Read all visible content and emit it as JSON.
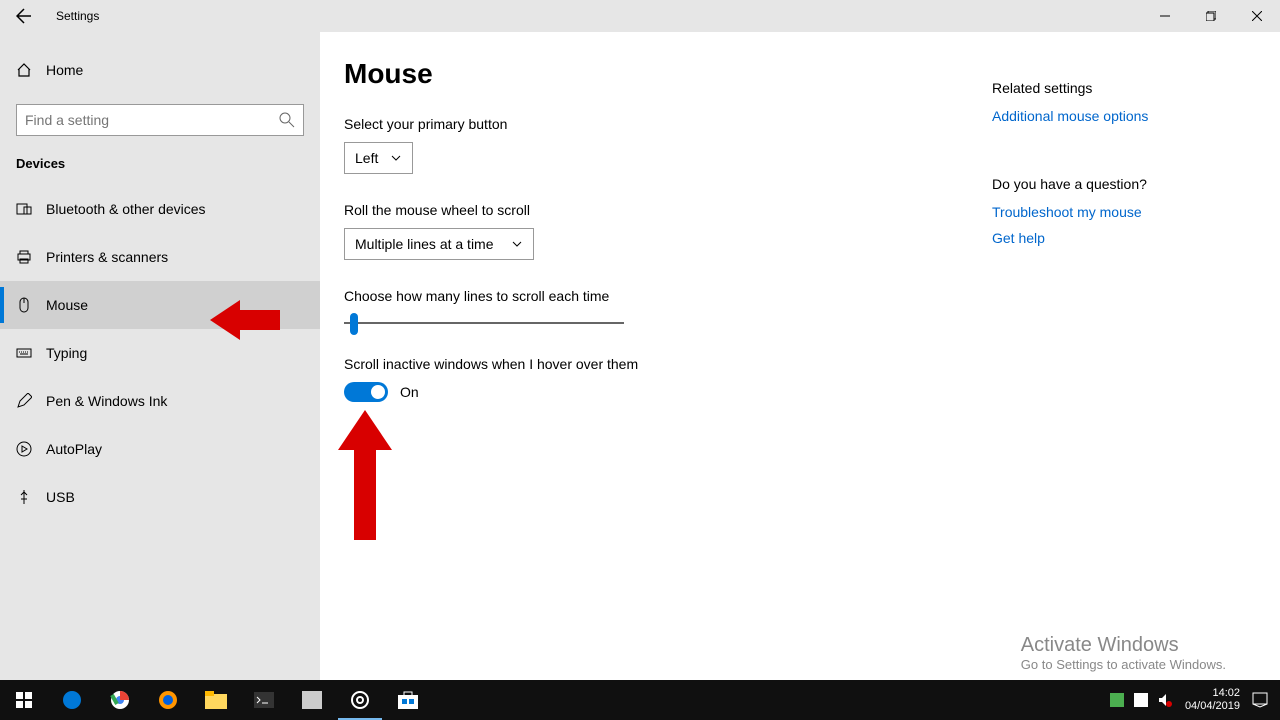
{
  "titlebar": {
    "title": "Settings"
  },
  "sidebar": {
    "home": "Home",
    "search_placeholder": "Find a setting",
    "category": "Devices",
    "items": [
      {
        "label": "Bluetooth & other devices"
      },
      {
        "label": "Printers & scanners"
      },
      {
        "label": "Mouse"
      },
      {
        "label": "Typing"
      },
      {
        "label": "Pen & Windows Ink"
      },
      {
        "label": "AutoPlay"
      },
      {
        "label": "USB"
      }
    ]
  },
  "page": {
    "title": "Mouse",
    "primary_button_label": "Select your primary button",
    "primary_button_value": "Left",
    "scroll_wheel_label": "Roll the mouse wheel to scroll",
    "scroll_wheel_value": "Multiple lines at a time",
    "lines_label": "Choose how many lines to scroll each time",
    "inactive_label": "Scroll inactive windows when I hover over them",
    "toggle_state": "On"
  },
  "side": {
    "related_heading": "Related settings",
    "related_link": "Additional mouse options",
    "question_heading": "Do you have a question?",
    "troubleshoot_link": "Troubleshoot my mouse",
    "help_link": "Get help"
  },
  "watermark": {
    "title": "Activate Windows",
    "sub": "Go to Settings to activate Windows."
  },
  "taskbar": {
    "time": "14:02",
    "date": "04/04/2019"
  }
}
